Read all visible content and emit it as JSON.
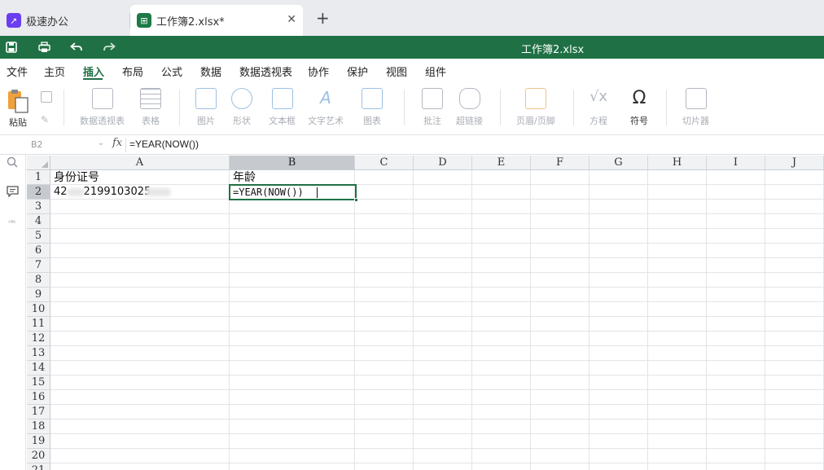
{
  "tabs": [
    {
      "label": "极速办公",
      "icon": "rocket-icon"
    },
    {
      "label": "工作簿2.xlsx*",
      "icon": "sheet-icon"
    }
  ],
  "new_tab_label": "+",
  "title": "工作簿2.xlsx",
  "menu": [
    "文件",
    "主页",
    "插入",
    "布局",
    "公式",
    "数据",
    "数据透视表",
    "协作",
    "保护",
    "视图",
    "组件"
  ],
  "active_menu": "插入",
  "ribbon": {
    "paste": "粘贴",
    "pivot": "数据透视表",
    "table": "表格",
    "image": "图片",
    "shape": "形状",
    "textbox": "文本框",
    "wordart": "文字艺术",
    "chart": "图表",
    "comment": "批注",
    "hyperlink": "超链接",
    "header_footer": "页眉/页脚",
    "equation": "方程",
    "symbol": "符号",
    "slicer": "切片器"
  },
  "formula_bar": {
    "name_box": "B2",
    "fx": "fx",
    "formula": "=YEAR(NOW())"
  },
  "columns": [
    "A",
    "B",
    "C",
    "D",
    "E",
    "F",
    "G",
    "H",
    "I",
    "J"
  ],
  "rows": [
    "1",
    "2",
    "3",
    "4",
    "5",
    "6",
    "7",
    "8",
    "9",
    "10",
    "11",
    "12",
    "13",
    "14",
    "15",
    "16",
    "17",
    "18",
    "19",
    "20",
    "21"
  ],
  "cells": {
    "A1": "身份证号",
    "B1": "年龄",
    "A2_visible_prefix": "42",
    "A2_visible_middle": "2199103025",
    "B2": "=YEAR(NOW())"
  }
}
